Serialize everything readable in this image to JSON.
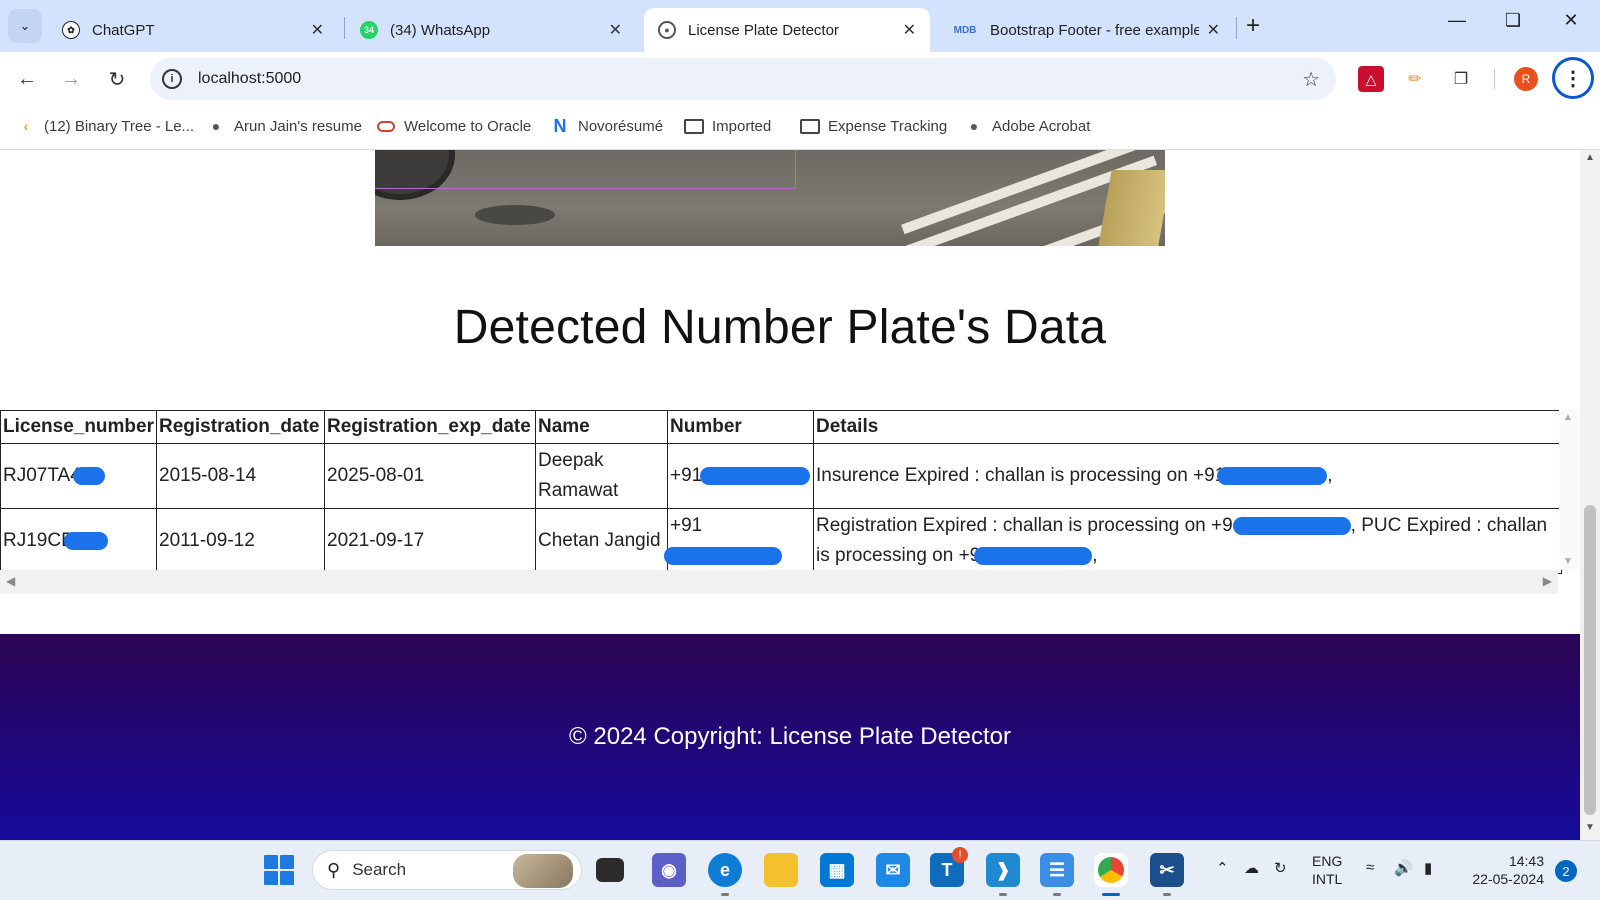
{
  "tabs": [
    {
      "label": "ChatGPT",
      "icon": "chatgpt-icon"
    },
    {
      "label": "(34) WhatsApp",
      "icon": "whatsapp-icon",
      "badge": "34"
    },
    {
      "label": "License Plate Detector",
      "icon": "globe-icon",
      "active": true
    },
    {
      "label": "Bootstrap Footer - free example",
      "icon": "mdb-icon"
    }
  ],
  "toolbar": {
    "url": "localhost:5000"
  },
  "bookmarks": [
    {
      "label": "(12) Binary Tree - Le...",
      "icon": "leetcode-icon"
    },
    {
      "label": "Arun Jain's resume",
      "icon": "globe-icon"
    },
    {
      "label": "Welcome to Oracle",
      "icon": "oracle-icon"
    },
    {
      "label": "Novorésumé",
      "icon": "novoresume-icon"
    },
    {
      "label": "Imported",
      "icon": "folder-icon"
    },
    {
      "label": "Expense Tracking",
      "icon": "folder-icon"
    },
    {
      "label": "Adobe Acrobat",
      "icon": "globe-icon"
    }
  ],
  "profile_initial": "R",
  "page": {
    "heading": "Detected Number Plate's Data",
    "table": {
      "headers": [
        "License_number",
        "Registration_date",
        "Registration_exp_date",
        "Name",
        "Number",
        "Details"
      ],
      "rows": [
        {
          "license": "RJ07TA4",
          "reg_date": "2015-08-14",
          "exp_date": "2025-08-01",
          "name": "Deepak Ramawat",
          "number": "+91",
          "details": "Insurence Expired : challan is processing on +91",
          "details_tail": ","
        },
        {
          "license": "RJ19CE",
          "reg_date": "2011-09-12",
          "exp_date": "2021-09-17",
          "name": "Chetan Jangid",
          "number": "+91",
          "details": "Registration Expired : challan is processing on +9",
          "details_mid": ", PUC Expired : challan is processing on +9",
          "details_tail": ","
        }
      ]
    },
    "footer": "© 2024 Copyright: License Plate Detector"
  },
  "taskbar": {
    "search_placeholder": "Search",
    "language": "ENG",
    "layout": "INTL",
    "time": "14:43",
    "date": "22-05-2024",
    "notifications": "2"
  },
  "colors": {
    "footer_top": "#2c0553",
    "footer_bottom": "#160a9a",
    "redaction": "#1a73e8"
  }
}
